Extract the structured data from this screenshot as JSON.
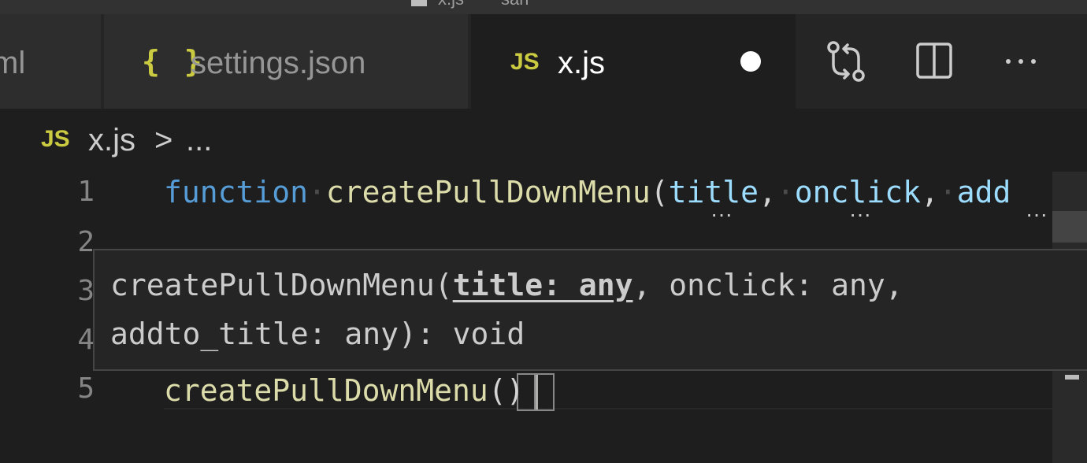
{
  "window": {
    "title": "x.js",
    "title_extra": "sari"
  },
  "tabs": [
    {
      "label": "ml",
      "icon": "xml-file-icon",
      "active": false
    },
    {
      "label": "settings.json",
      "icon_glyph": "{ }",
      "icon": "json-file-icon",
      "active": false
    },
    {
      "label": "x.js",
      "icon_glyph": "JS",
      "icon": "javascript-file-icon",
      "active": true,
      "dirty": true
    }
  ],
  "editor_actions": [
    "open-changes-icon",
    "split-editor-icon",
    "more-actions-icon"
  ],
  "breadcrumb": {
    "icon_glyph": "JS",
    "file": "x.js",
    "separator": ">",
    "more": "..."
  },
  "lines": [
    {
      "number": "1",
      "keyword": "function",
      "name": "createPullDownMenu",
      "open_paren": "(",
      "params": [
        "title",
        "onclick",
        "add"
      ],
      "comma": ","
    },
    {
      "number": "2"
    },
    {
      "number": "3"
    },
    {
      "number": "4"
    },
    {
      "number": "5",
      "name": "createPullDownMenu",
      "open_paren": "(",
      "close_paren": ")"
    }
  ],
  "hover": {
    "line1_prefix": "createPullDownMenu(",
    "line1_active": "title: any",
    "line1_suffix": ", onclick: any,",
    "line2": "addto_title: any): void"
  },
  "colors": {
    "editor_bg": "#1e1e1e",
    "keyword": "#569cd6",
    "function": "#dcdcaa",
    "parameter": "#9cdcfe",
    "js_icon": "#cbcb41"
  }
}
